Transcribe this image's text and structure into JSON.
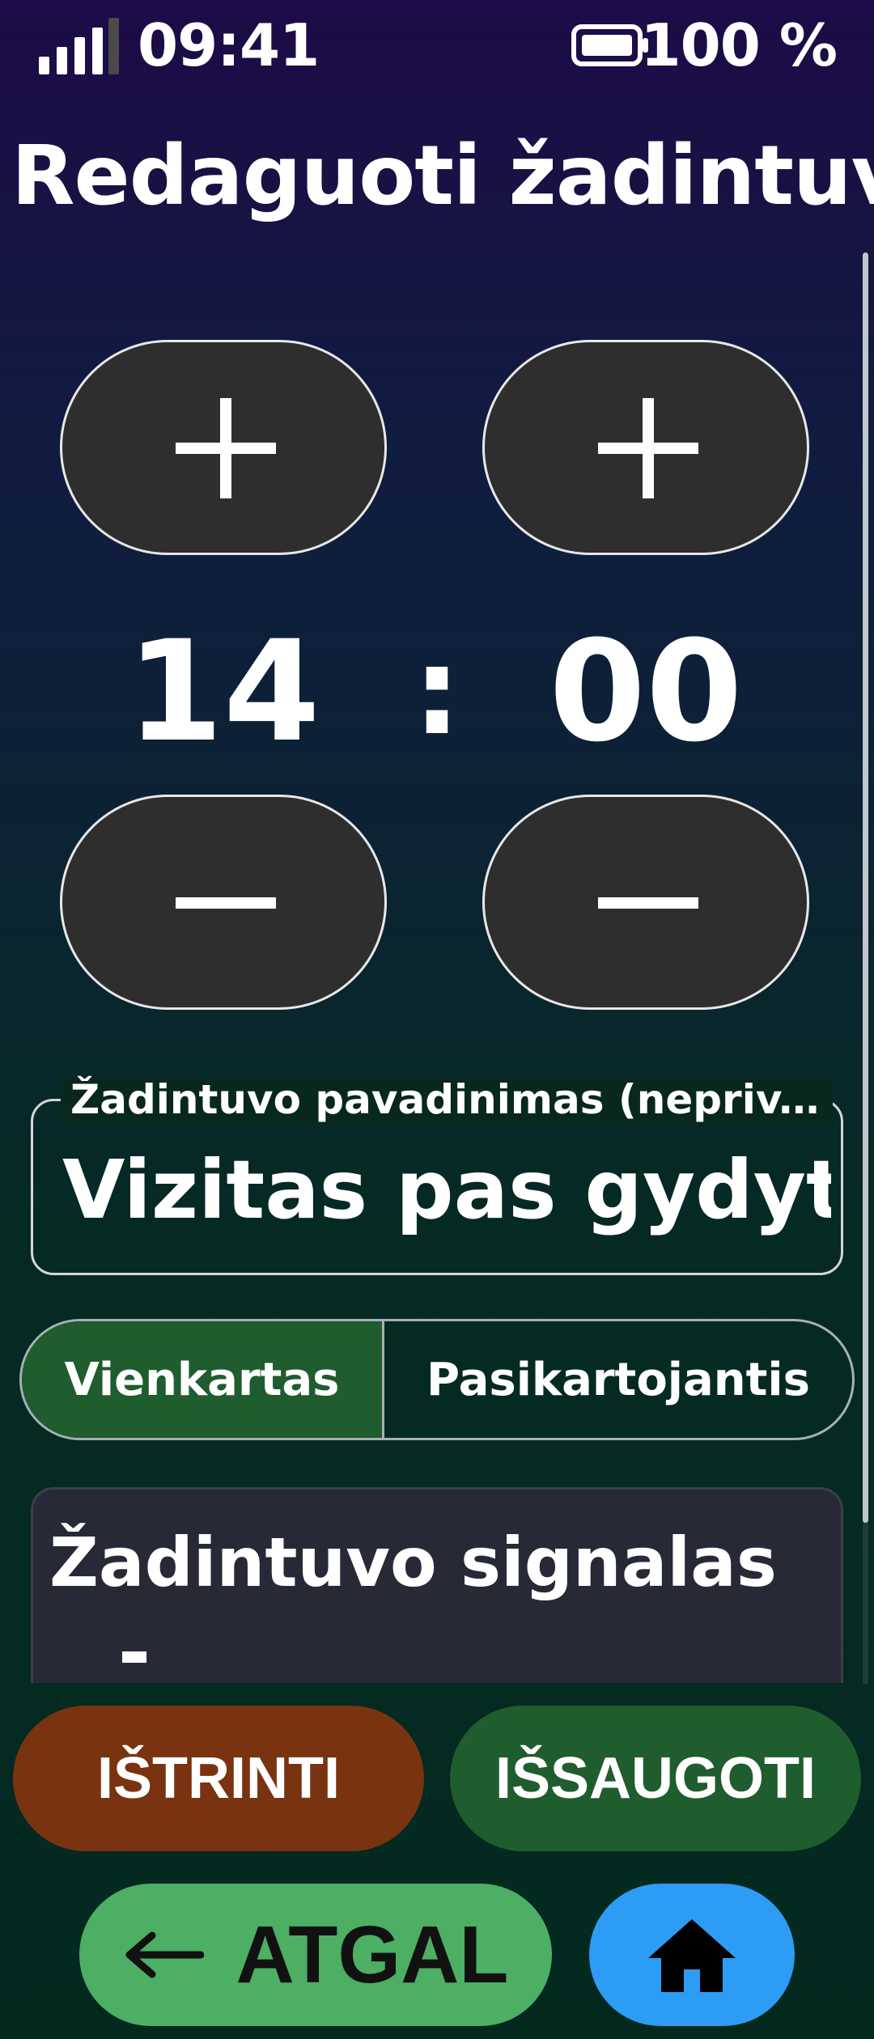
{
  "status_bar": {
    "time": "09:41",
    "battery": "100 %",
    "signal_icon": "signal-strength-icon",
    "battery_icon": "battery-full-icon"
  },
  "title": "Redaguoti žadintuvą",
  "time_picker": {
    "hours": "14",
    "separator": ":",
    "minutes": "00",
    "increment_icon": "plus-icon",
    "decrement_icon": "minus-icon"
  },
  "name_field": {
    "label": "Žadintuvo pavadinimas (nepriv...",
    "value": "Vizitas pas gydytoj"
  },
  "repeat_mode": {
    "options": [
      "Vienkartas",
      "Pasikartojantis"
    ],
    "selected": "Vienkartas"
  },
  "signal_section": {
    "title": "Žadintuvo signalas"
  },
  "actions": {
    "delete_label": "IŠTRINTI",
    "save_label": "IŠSAUGOTI",
    "back_label": "ATGAL",
    "back_icon": "arrow-left-icon",
    "home_icon": "home-icon"
  },
  "colors": {
    "delete": "#7a3310",
    "save": "#1f5c2e",
    "back": "#4caf64",
    "home": "#2d9cf5",
    "stepper": "#2e2e2e",
    "selected_segment": "#1f5c2e"
  }
}
